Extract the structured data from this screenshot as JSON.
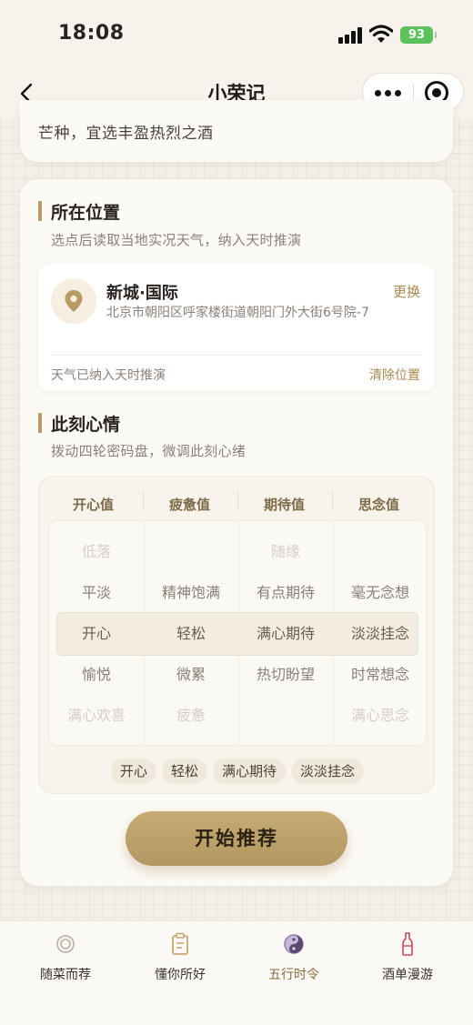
{
  "status_bar": {
    "time": "18:08",
    "battery": "93"
  },
  "nav": {
    "title": "小荣记"
  },
  "top_card": {
    "text": "芒种，宜选丰盈热烈之酒"
  },
  "location": {
    "title": "所在位置",
    "subtitle": "选点后读取当地实况天气，纳入天时推演",
    "name": "新城·国际",
    "address": "北京市朝阳区呼家楼街道朝阳门外大街6号院-7",
    "change": "更换",
    "note": "天气已纳入天时推演",
    "clear": "清除位置"
  },
  "mood": {
    "title": "此刻心情",
    "subtitle": "拨动四轮密码盘，微调此刻心绪",
    "columns": [
      {
        "header": "开心值",
        "items": [
          "低落",
          "平淡",
          "开心",
          "愉悦",
          "满心欢喜"
        ]
      },
      {
        "header": "疲惫值",
        "items": [
          "",
          "精神饱满",
          "轻松",
          "微累",
          "疲惫"
        ]
      },
      {
        "header": "期待值",
        "items": [
          "随缘",
          "有点期待",
          "满心期待",
          "热切盼望",
          ""
        ]
      },
      {
        "header": "思念值",
        "items": [
          "",
          "毫无念想",
          "淡淡挂念",
          "时常想念",
          "满心思念"
        ]
      }
    ],
    "selected": [
      "开心",
      "轻松",
      "满心期待",
      "淡淡挂念"
    ]
  },
  "start_button": "开始推荐",
  "tabs": [
    {
      "label": "随菜而荐",
      "icon": "ring-icon",
      "active": false
    },
    {
      "label": "懂你所好",
      "icon": "clipboard-icon",
      "active": false
    },
    {
      "label": "五行时令",
      "icon": "yin-yang-icon",
      "active": true
    },
    {
      "label": "酒单漫游",
      "icon": "wine-bottle-icon",
      "active": false
    }
  ],
  "colors": {
    "accent": "#b89b62",
    "accent_text": "#a8884f",
    "battery": "#5cc15a"
  }
}
